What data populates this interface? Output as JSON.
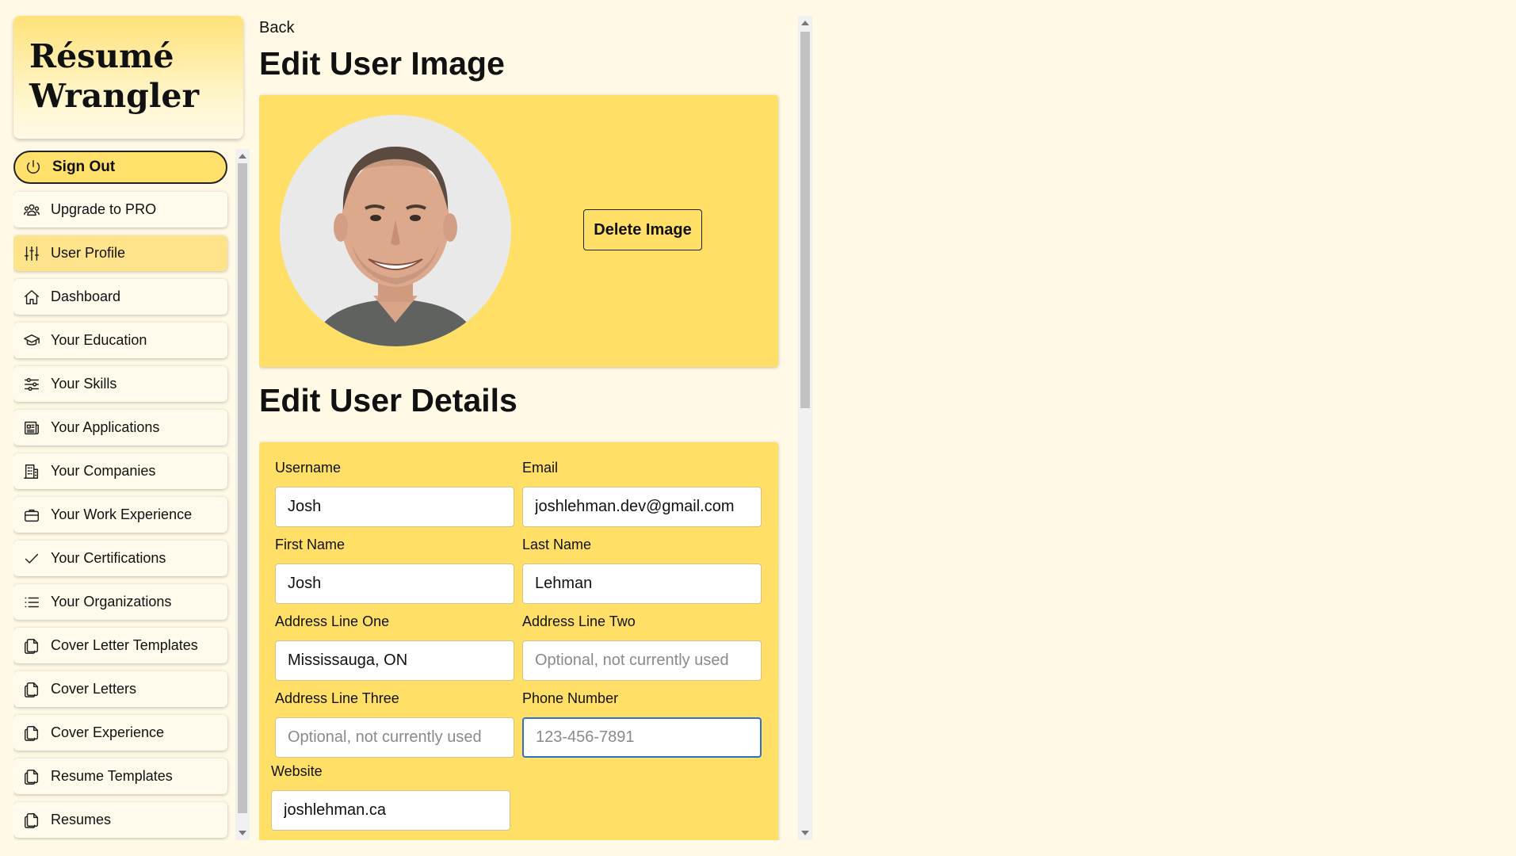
{
  "brand": {
    "logo_text": "Résumé\nWrangler"
  },
  "sidebar": {
    "sign_out": "Sign Out",
    "items": [
      {
        "label": "Upgrade to PRO",
        "icon": "users-icon"
      },
      {
        "label": "User Profile",
        "icon": "sliders-icon",
        "active": true
      },
      {
        "label": "Dashboard",
        "icon": "home-icon"
      },
      {
        "label": "Your Education",
        "icon": "graduation-cap-icon"
      },
      {
        "label": "Your Skills",
        "icon": "adjustments-icon"
      },
      {
        "label": "Your Applications",
        "icon": "newspaper-icon"
      },
      {
        "label": "Your Companies",
        "icon": "building-icon"
      },
      {
        "label": "Your Work Experience",
        "icon": "briefcase-icon"
      },
      {
        "label": "Your Certifications",
        "icon": "check-icon"
      },
      {
        "label": "Your Organizations",
        "icon": "list-icon"
      },
      {
        "label": "Cover Letter Templates",
        "icon": "copy-icon"
      },
      {
        "label": "Cover Letters",
        "icon": "copy-icon"
      },
      {
        "label": "Cover Experience",
        "icon": "copy-icon"
      },
      {
        "label": "Resume Templates",
        "icon": "copy-icon"
      },
      {
        "label": "Resumes",
        "icon": "copy-icon"
      }
    ]
  },
  "main": {
    "back": "Back",
    "image_title": "Edit User Image",
    "delete_image": "Delete Image",
    "details_title": "Edit User Details",
    "fields": {
      "username": {
        "label": "Username",
        "value": "Josh"
      },
      "email": {
        "label": "Email",
        "value": "joshlehman.dev@gmail.com"
      },
      "first_name": {
        "label": "First Name",
        "value": "Josh"
      },
      "last_name": {
        "label": "Last Name",
        "value": "Lehman"
      },
      "address1": {
        "label": "Address Line One",
        "value": "Mississauga, ON"
      },
      "address2": {
        "label": "Address Line Two",
        "value": "",
        "placeholder": "Optional, not currently used"
      },
      "address3": {
        "label": "Address Line Three",
        "value": "",
        "placeholder": "Optional, not currently used"
      },
      "phone": {
        "label": "Phone Number",
        "value": "",
        "placeholder": "123-456-7891"
      },
      "website": {
        "label": "Website",
        "value": "joshlehman.ca"
      }
    }
  },
  "colors": {
    "accent": "#ffdf65",
    "background": "#fff9e6",
    "focus": "#2f6fd0"
  }
}
